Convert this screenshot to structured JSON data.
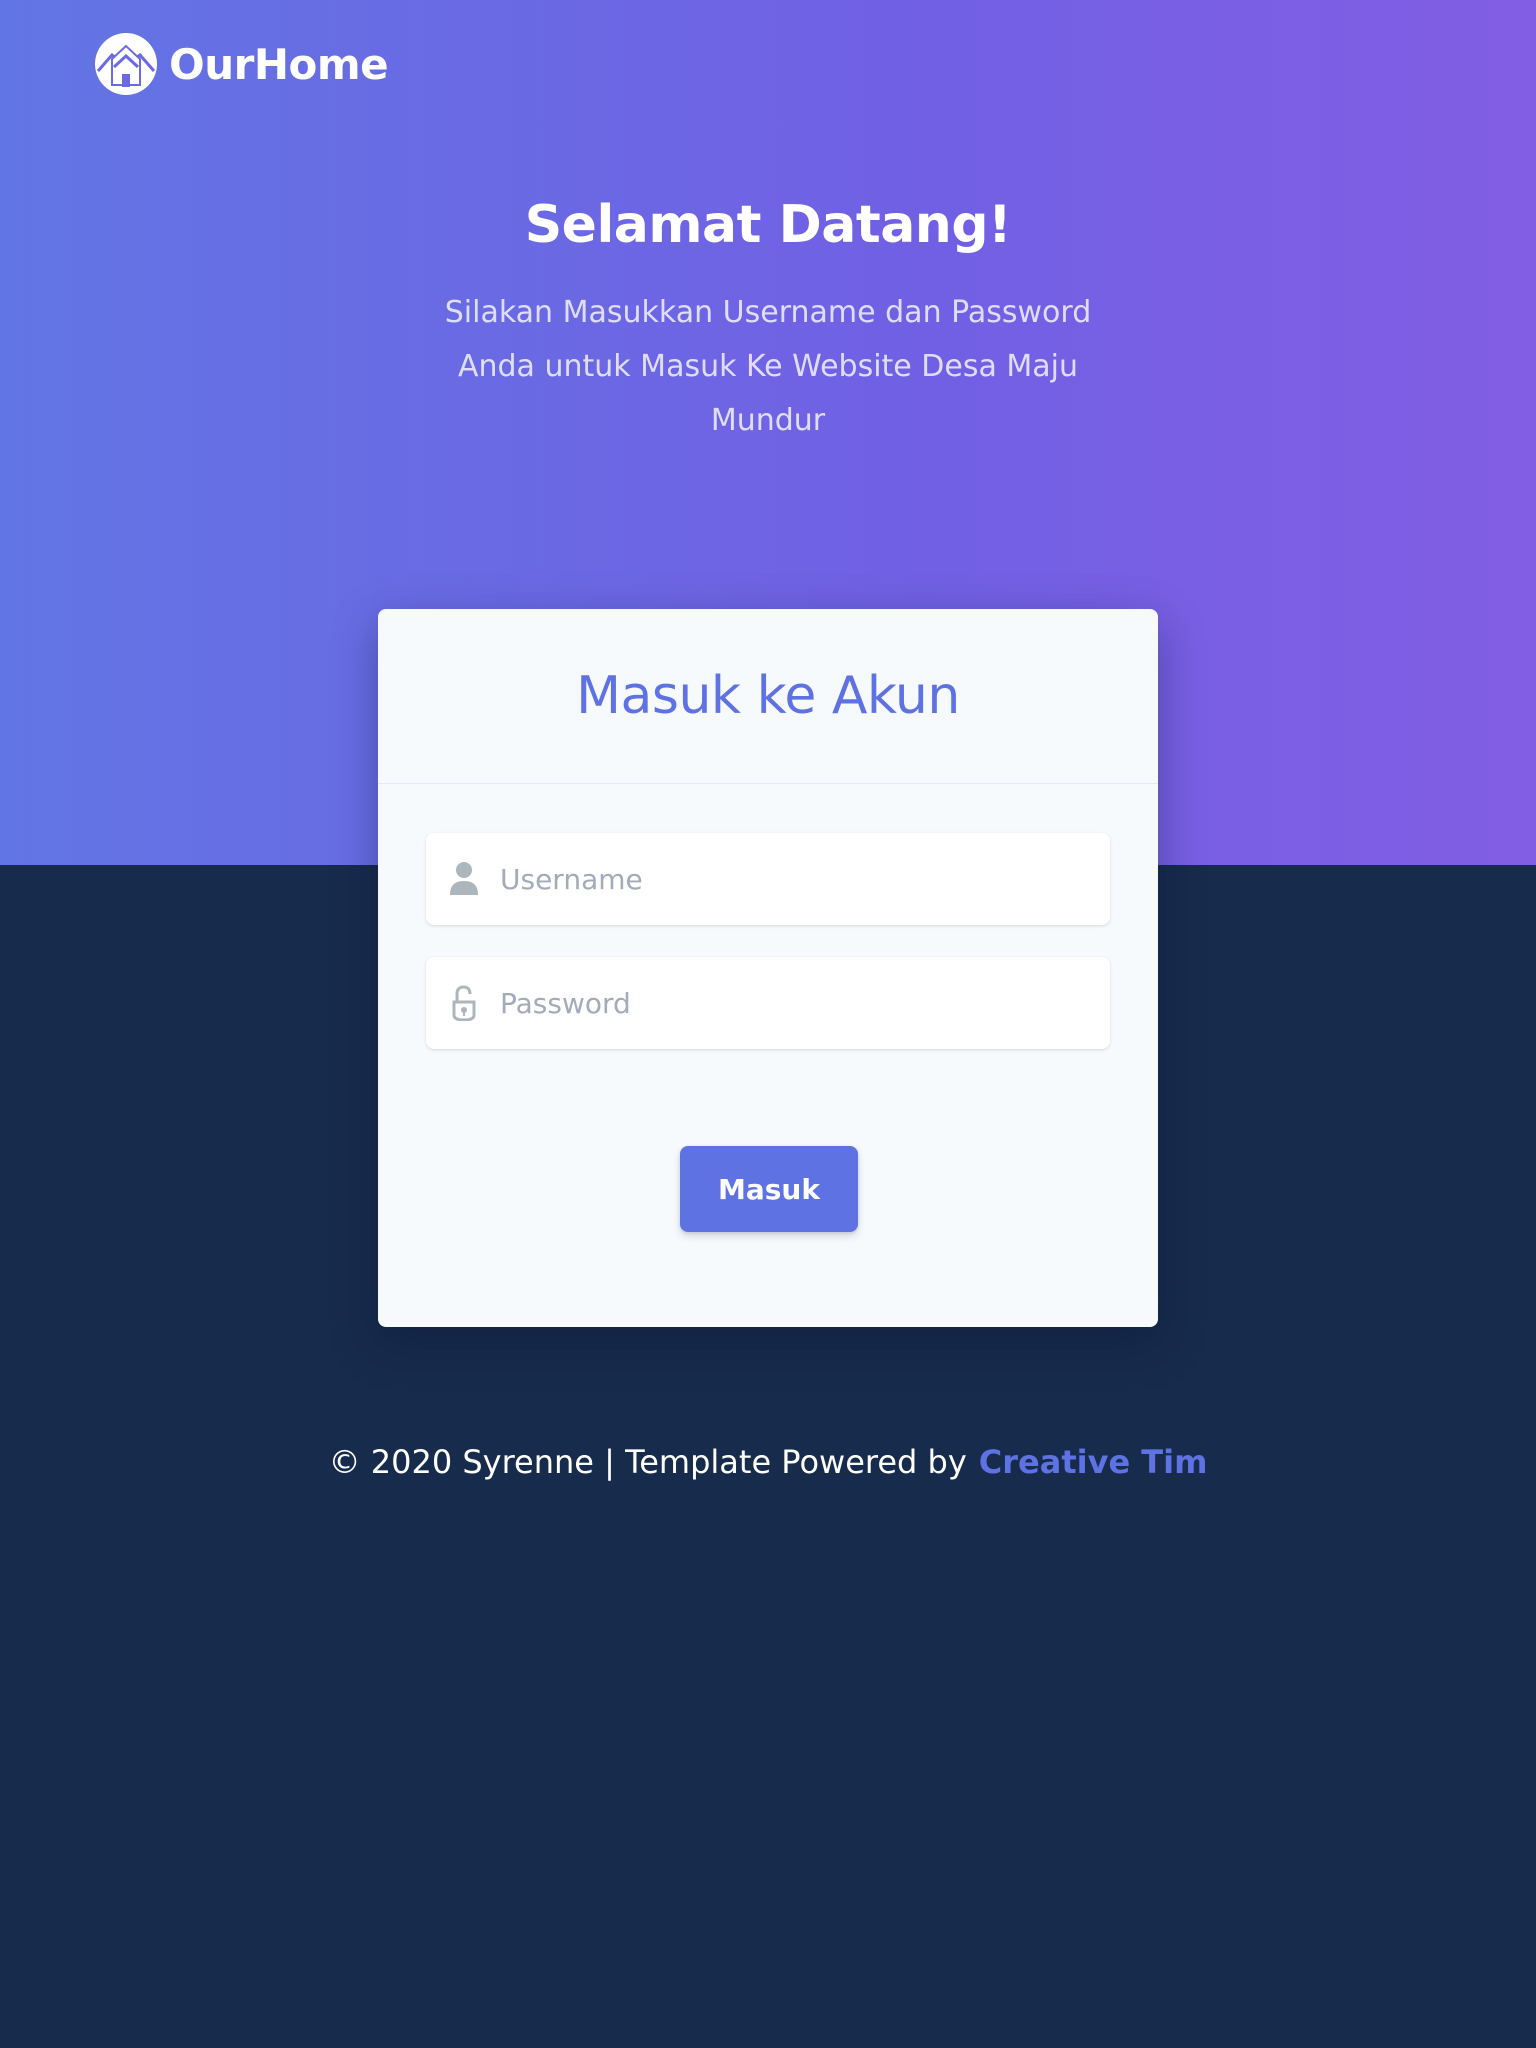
{
  "brand": {
    "name": "OurHome",
    "logo_icon": "house-logo-icon"
  },
  "hero": {
    "title": "Selamat Datang!",
    "lead": "Silakan Masukkan Username dan Password Anda untuk Masuk Ke Website Desa Maju Mundur"
  },
  "login_card": {
    "title": "Masuk ke Akun",
    "username": {
      "placeholder": "Username",
      "value": "",
      "icon": "user-icon"
    },
    "password": {
      "placeholder": "Password",
      "value": "",
      "icon": "unlock-icon"
    },
    "submit_label": "Masuk"
  },
  "footer": {
    "text": "© 2020 Syrenne | Template Powered by",
    "link_label": "Creative Tim"
  },
  "colors": {
    "primary": "#5e72e4",
    "hero_start": "#6275e4",
    "hero_end": "#825ee4",
    "background": "#172b4d",
    "card": "#f7fafc"
  }
}
